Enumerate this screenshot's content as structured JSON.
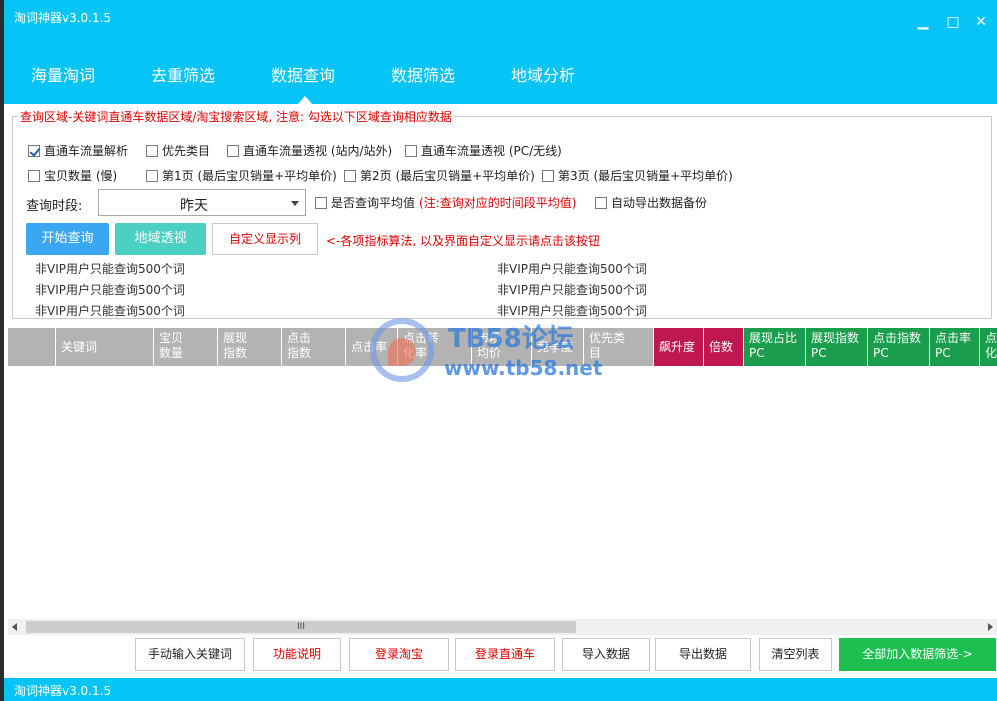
{
  "window": {
    "title": "淘词神器v3.0.1.5",
    "minimize": "▁",
    "maximize": "□",
    "close": "✕"
  },
  "tabs": [
    {
      "label": "海量淘词"
    },
    {
      "label": "去重筛选"
    },
    {
      "label": "数据查询",
      "active": true
    },
    {
      "label": "数据筛选"
    },
    {
      "label": "地域分析"
    }
  ],
  "query": {
    "legend": "查询区域-关键词直通车数据区域/淘宝搜索区域, 注意: 勾选以下区域查询相应数据",
    "options_row1": [
      {
        "label": "直通车流量解析",
        "checked": true
      },
      {
        "label": "优先类目",
        "checked": false
      },
      {
        "label": "直通车流量透视 (站内/站外)",
        "checked": false
      },
      {
        "label": "直通车流量透视 (PC/无线)",
        "checked": false
      }
    ],
    "options_row2": [
      {
        "label": "宝贝数量 (慢)",
        "checked": false
      },
      {
        "label": "第1页 (最后宝贝销量+平均单价)",
        "checked": false
      },
      {
        "label": "第2页 (最后宝贝销量+平均单价)",
        "checked": false
      },
      {
        "label": "第3页 (最后宝贝销量+平均单价)",
        "checked": false
      }
    ],
    "period_label": "查询时段:",
    "period_value": "昨天",
    "avg_label": "是否查询平均值",
    "avg_note": "(注:查询对应的时间段平均值)",
    "backup_label": "自动导出数据备份",
    "start_button": "开始查询",
    "region_button": "地域透视",
    "custom_button": "自定义显示列",
    "hint": "<-各项指标算法, 以及界面自定义显示请点击该按钮",
    "vip_notes": [
      "非VIP用户只能查询500个词",
      "非VIP用户只能查询500个词",
      "非VIP用户只能查询500个词",
      "非VIP用户只能查询500个词",
      "非VIP用户只能查询500个词",
      "非VIP用户只能查询500个词"
    ]
  },
  "grid": {
    "columns": [
      {
        "l1": "",
        "l2": "",
        "color": "#b3b3b3"
      },
      {
        "l1": "关键词",
        "l2": "",
        "color": "#b3b3b3"
      },
      {
        "l1": "宝贝",
        "l2": "数量",
        "color": "#b3b3b3"
      },
      {
        "l1": "展现",
        "l2": "指数",
        "color": "#b3b3b3"
      },
      {
        "l1": "点击",
        "l2": "指数",
        "color": "#b3b3b3"
      },
      {
        "l1": "点击率",
        "l2": "",
        "color": "#b3b3b3"
      },
      {
        "l1": "点击转",
        "l2": "化率",
        "color": "#b3b3b3"
      },
      {
        "l1": "市场",
        "l2": "均价",
        "color": "#b3b3b3"
      },
      {
        "l1": "竞争度",
        "l2": "",
        "color": "#b3b3b3"
      },
      {
        "l1": "优先类",
        "l2": "目",
        "color": "#b3b3b3"
      },
      {
        "l1": "飙升度",
        "l2": "",
        "color": "#c0174f"
      },
      {
        "l1": "倍数",
        "l2": "",
        "color": "#c0174f"
      },
      {
        "l1": "展现占比",
        "l2": "PC",
        "color": "#1a9d4c"
      },
      {
        "l1": "展现指数",
        "l2": "PC",
        "color": "#1a9d4c"
      },
      {
        "l1": "点击指数",
        "l2": "PC",
        "color": "#1a9d4c"
      },
      {
        "l1": "点击率",
        "l2": "PC",
        "color": "#1a9d4c"
      },
      {
        "l1": "点",
        "l2": "化",
        "color": "#1a9d4c"
      }
    ],
    "scroll_grip": "III"
  },
  "watermark": {
    "title": "TB58论坛",
    "url": "www.tb58.net"
  },
  "bottom_buttons": [
    {
      "label": "手动输入关键词",
      "style": "dark"
    },
    {
      "label": "功能说明",
      "style": "red"
    },
    {
      "label": "登录淘宝",
      "style": "red"
    },
    {
      "label": "登录直通车",
      "style": "red"
    },
    {
      "label": "导入数据",
      "style": "dark"
    },
    {
      "label": "导出数据",
      "style": "dark"
    },
    {
      "label": "清空列表",
      "style": "dark"
    },
    {
      "label": "全部加入数据筛选->",
      "style": "green"
    }
  ],
  "status": {
    "title": "淘词神器v3.0.1.5"
  },
  "colors": {
    "accent": "#06c4f5",
    "primary_button": "#3ba7f2",
    "secondary_button": "#4cd0c2",
    "green_button": "#1dbf51"
  }
}
